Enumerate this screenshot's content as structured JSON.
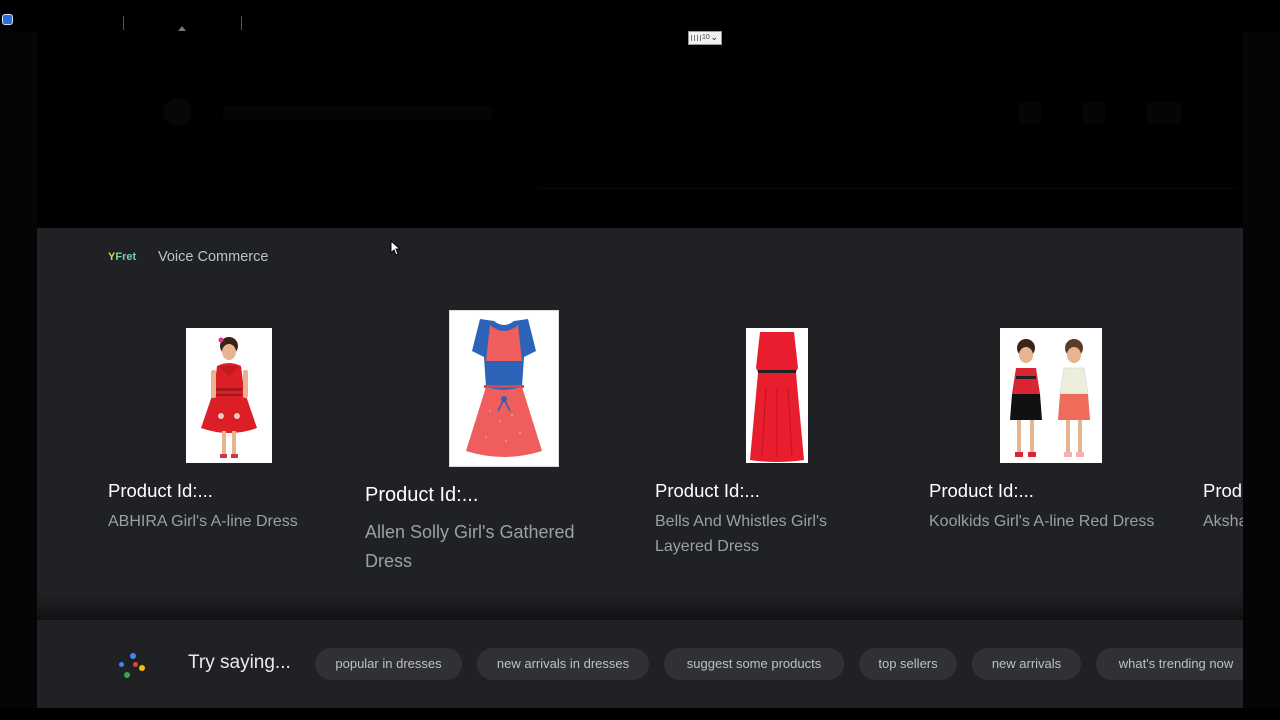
{
  "select_widget": {
    "value": "10"
  },
  "brand": {
    "logo_y": "Y",
    "logo_rest": "Fret",
    "title": "Voice Commerce"
  },
  "products": [
    {
      "id_label": "Product Id:...",
      "name": "ABHIRA Girl's A-line Dress"
    },
    {
      "id_label": "Product Id:...",
      "name": "Allen Solly Girl's Gathered Dress"
    },
    {
      "id_label": "Product Id:...",
      "name": "Bells And Whistles Girl's Layered Dress"
    },
    {
      "id_label": "Product Id:...",
      "name": "Koolkids Girl's A-line Red Dress"
    },
    {
      "id_label": "Product Id:...",
      "name": "Aksha"
    }
  ],
  "assistant": {
    "try_label": "Try saying...",
    "suggestions": [
      "popular in dresses",
      "new arrivals in dresses",
      "suggest some products",
      "top sellers",
      "new arrivals",
      "what's trending now"
    ]
  },
  "colors": {
    "background": "#202124",
    "chip": "#303134",
    "muted_text": "#9aa0a6"
  },
  "icons": [
    "app-icon",
    "google-assistant-icon",
    "mouse-cursor-icon",
    "chevron-down-icon"
  ]
}
